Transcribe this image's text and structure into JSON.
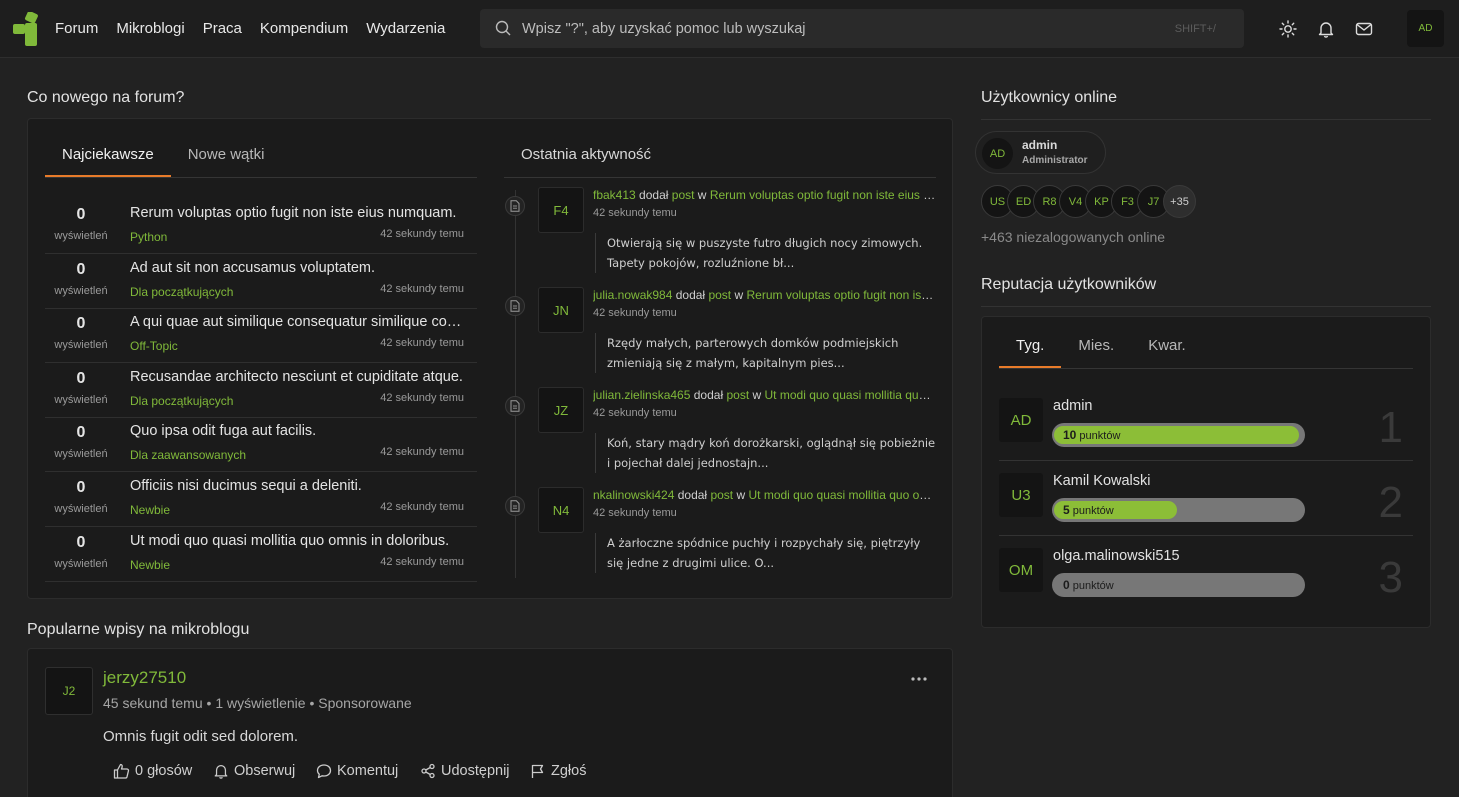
{
  "nav": {
    "links": [
      "Forum",
      "Mikroblogi",
      "Praca",
      "Kompendium",
      "Wydarzenia"
    ],
    "search_placeholder": "Wpisz \"?\", aby uzyskać pomoc lub wyszukaj",
    "search_shortcut": "SHIFT+/",
    "avatar": "AD"
  },
  "forum": {
    "heading": "Co nowego na forum?",
    "tabs": [
      "Najciekawsze",
      "Nowe wątki"
    ],
    "activity_heading": "Ostatnia aktywność",
    "topics": [
      {
        "count": "0",
        "views": "wyświetleń",
        "title": "Rerum voluptas optio fugit non iste eius numquam.",
        "category": "Python",
        "time": "42 sekundy temu"
      },
      {
        "count": "0",
        "views": "wyświetleń",
        "title": "Ad aut sit non accusamus voluptatem.",
        "category": "Dla początkujących",
        "time": "42 sekundy temu"
      },
      {
        "count": "0",
        "views": "wyświetleń",
        "title": "A qui quae aut similique consequatur similique corrupti.",
        "category": "Off-Topic",
        "time": "42 sekundy temu"
      },
      {
        "count": "0",
        "views": "wyświetleń",
        "title": "Recusandae architecto nesciunt et cupiditate atque.",
        "category": "Dla początkujących",
        "time": "42 sekundy temu"
      },
      {
        "count": "0",
        "views": "wyświetleń",
        "title": "Quo ipsa odit fuga aut facilis.",
        "category": "Dla zaawansowanych",
        "time": "42 sekundy temu"
      },
      {
        "count": "0",
        "views": "wyświetleń",
        "title": "Officiis nisi ducimus sequi a deleniti.",
        "category": "Newbie",
        "time": "42 sekundy temu"
      },
      {
        "count": "0",
        "views": "wyświetleń",
        "title": "Ut modi quo quasi mollitia quo omnis in doloribus.",
        "category": "Newbie",
        "time": "42 sekundy temu"
      }
    ],
    "activity": [
      {
        "avatar": "F4",
        "user": "fbak413",
        "verb": "dodał",
        "type": "post",
        "in": "w",
        "topic": "Rerum voluptas optio fugit non iste eius numquam.",
        "time": "42 sekundy temu",
        "excerpt": "Otwierają się w puszyste futro długich nocy zimowych. Tapety pokojów, rozluźnione bł..."
      },
      {
        "avatar": "JN",
        "user": "julia.nowak984",
        "verb": "dodał",
        "type": "post",
        "in": "w",
        "topic": "Rerum voluptas optio fugit non iste eius numquam.",
        "time": "42 sekundy temu",
        "excerpt": "Rzędy małych, parterowych domków podmiejskich zmieniają się z małym, kapitalnym pies..."
      },
      {
        "avatar": "JZ",
        "user": "julian.zielinska465",
        "verb": "dodał",
        "type": "post",
        "in": "w",
        "topic": "Ut modi quo quasi mollitia quo omnis in doloribus.",
        "time": "42 sekundy temu",
        "excerpt": "Koń, stary mądry koń dorożkarski, oglądnął się pobieżnie i pojechał dalej jednostajn..."
      },
      {
        "avatar": "N4",
        "user": "nkalinowski424",
        "verb": "dodał",
        "type": "post",
        "in": "w",
        "topic": "Ut modi quo quasi mollitia quo omnis in doloribus.",
        "time": "42 sekundy temu",
        "excerpt": "A żarłoczne spódnice puchły i rozpychały się, piętrzyły się jedne z drugimi ulice. O..."
      }
    ]
  },
  "online": {
    "heading": "Użytkownicy online",
    "main_user": {
      "avatar": "AD",
      "name": "admin",
      "role": "Administrator"
    },
    "avatars": [
      "US",
      "ED",
      "R8",
      "V4",
      "KP",
      "F3",
      "J7"
    ],
    "more": "+35",
    "guests": "+463 niezalogowanych online"
  },
  "reputation": {
    "heading": "Reputacja użytkowników",
    "tabs": [
      "Tyg.",
      "Mies.",
      "Kwar."
    ],
    "unit": "punktów",
    "rows": [
      {
        "avatar": "AD",
        "name": "admin",
        "points": "10",
        "fraction": 1.0,
        "rank": "1"
      },
      {
        "avatar": "U3",
        "name": "Kamil Kowalski",
        "points": "5",
        "fraction": 0.5,
        "rank": "2"
      },
      {
        "avatar": "OM",
        "name": "olga.malinowski515",
        "points": "0",
        "fraction": 0,
        "rank": "3"
      }
    ]
  },
  "microblog": {
    "heading": "Popularne wpisy na mikroblogu",
    "post": {
      "avatar": "J2",
      "author": "jerzy27510",
      "time": "45 sekund temu",
      "views": "1 wyświetlenie",
      "sponsored": "Sponsorowane",
      "text": "Omnis fugit odit sed dolorem.",
      "actions": {
        "votes": "0 głosów",
        "follow": "Obserwuj",
        "comment": "Komentuj",
        "share": "Udostępnij",
        "report": "Zgłoś"
      }
    }
  },
  "colors": {
    "accent": "#80b93a",
    "tab_underline": "#e87b2a",
    "bg": "#222222",
    "panel": "#1b1b1b"
  }
}
